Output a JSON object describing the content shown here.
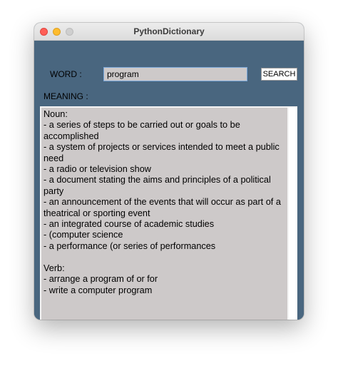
{
  "window": {
    "title": "PythonDictionary"
  },
  "form": {
    "word_label": "WORD :",
    "search_value": "program",
    "search_button": "SEARCH",
    "meaning_label": "MEANING :"
  },
  "meaning": {
    "text": "Noun:\n- a series of steps to be carried out or goals to be accomplished\n- a system of projects or services intended to meet a public need\n- a radio or television show\n- a document stating the aims and principles of a political party\n- an announcement of the events that will occur as part of a theatrical or sporting event\n- an integrated course of academic studies\n- (computer science\n- a performance (or series of performances\n\nVerb:\n- arrange a program of or for\n- write a computer program"
  }
}
